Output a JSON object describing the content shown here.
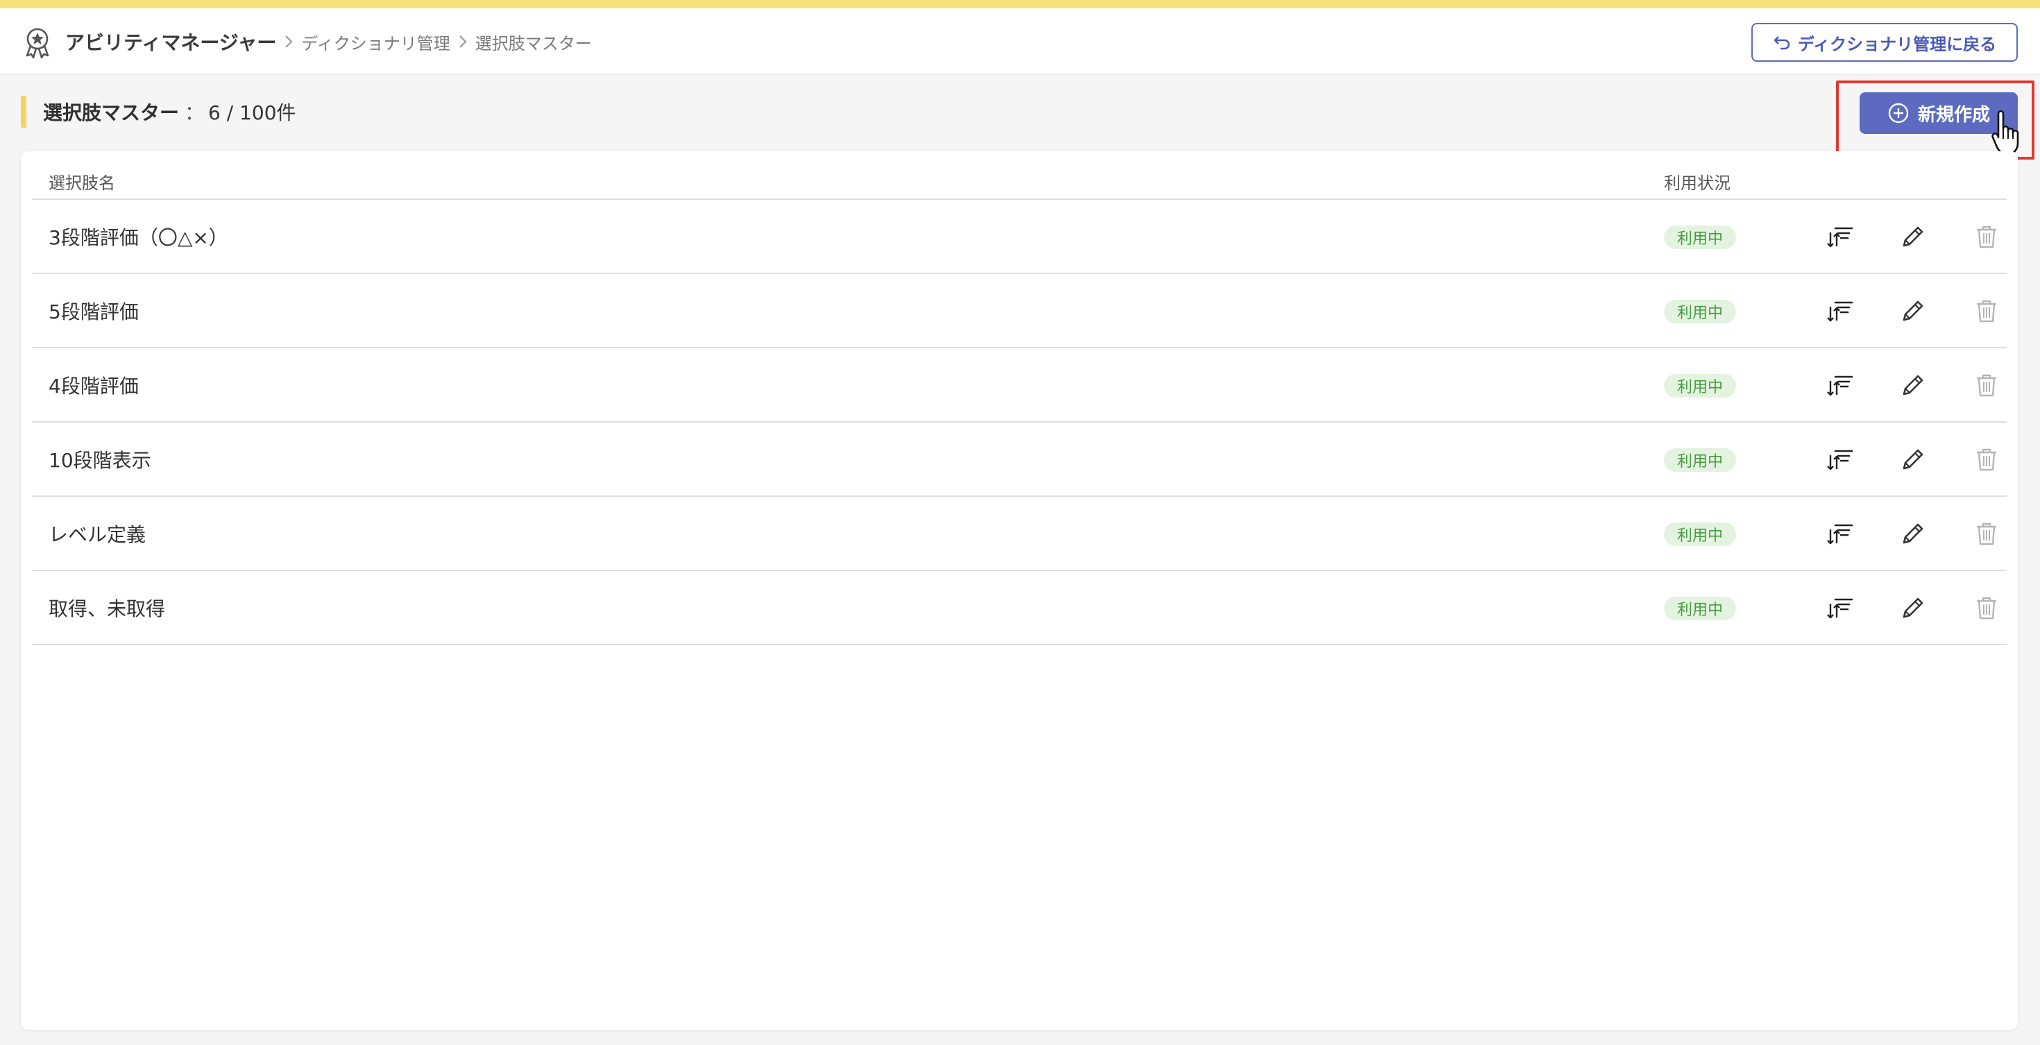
{
  "header": {
    "app_name": "アビリティマネージャー",
    "breadcrumbs": [
      "ディクショナリ管理",
      "選択肢マスター"
    ],
    "back_button_label": "ディクショナリ管理に戻る"
  },
  "section": {
    "title": "選択肢マスター",
    "count_separator": "：",
    "count": "6 / 100件",
    "new_button_label": "新規作成"
  },
  "table": {
    "columns": [
      "選択肢名",
      "利用状況"
    ],
    "rows": [
      {
        "name": "3段階評価（〇△×）",
        "status": "利用中"
      },
      {
        "name": "5段階評価",
        "status": "利用中"
      },
      {
        "name": "4段階評価",
        "status": "利用中"
      },
      {
        "name": "10段階表示",
        "status": "利用中"
      },
      {
        "name": "レベル定義",
        "status": "利用中"
      },
      {
        "name": "取得、未取得",
        "status": "利用中"
      }
    ]
  },
  "colors": {
    "accent": "#5c6bc0",
    "top_accent": "#f7e17a",
    "highlight": "#e03a2e",
    "badge_bg": "#e3f3df",
    "badge_text": "#4a9a45"
  },
  "icons": {
    "app": "award-icon",
    "breadcrumb_separator": "chevron-right-icon",
    "back": "undo-arrow-icon",
    "new": "plus-circle-icon",
    "sort": "sort-order-icon",
    "edit": "pencil-icon",
    "delete": "trash-icon",
    "cursor": "hand-pointer-cursor-icon"
  }
}
